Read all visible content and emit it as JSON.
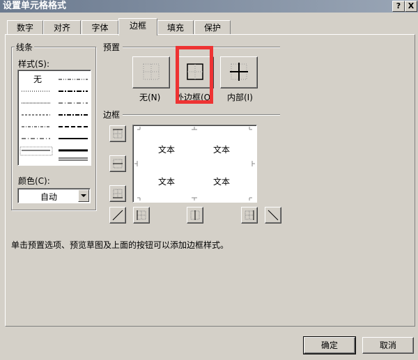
{
  "window": {
    "title": "设置单元格格式",
    "help_label": "?",
    "close_label": "X"
  },
  "tabs": [
    {
      "label": "数字"
    },
    {
      "label": "对齐"
    },
    {
      "label": "字体"
    },
    {
      "label": "边框",
      "active": true
    },
    {
      "label": "填充"
    },
    {
      "label": "保护"
    }
  ],
  "line_group": {
    "title": "线条",
    "style_label": "样式(S):",
    "none_label": "无",
    "color_label": "颜色(C):",
    "color_value": "自动"
  },
  "presets": {
    "title": "预置",
    "none_label": "无(N)",
    "outline_label": "外边框(O)",
    "inside_label": "内部(I)"
  },
  "border": {
    "title": "边框",
    "preview_texts": [
      "文本",
      "文本",
      "文本",
      "文本"
    ]
  },
  "hint": "单击预置选项、预览草图及上面的按钮可以添加边框样式。",
  "buttons": {
    "ok": "确定",
    "cancel": "取消"
  },
  "colors": {
    "highlight": "#ee3333"
  }
}
